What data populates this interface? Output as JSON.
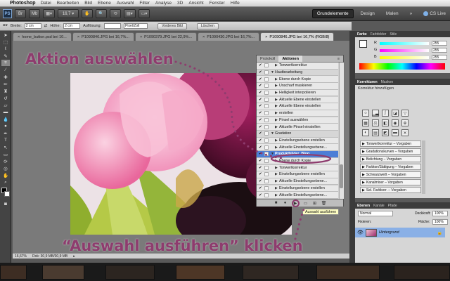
{
  "menubar": {
    "apple": "",
    "app_name": "Photoshop",
    "items": [
      "Datei",
      "Bearbeiten",
      "Bild",
      "Ebene",
      "Auswahl",
      "Filter",
      "Analyse",
      "3D",
      "Ansicht",
      "Fenster",
      "Hilfe"
    ]
  },
  "appbar": {
    "logo": "PS",
    "zoom": "16,7",
    "workspaces": [
      "Grundelemente",
      "Design",
      "Malen"
    ],
    "more": "»",
    "cs_live": "CS Live"
  },
  "options": {
    "width_label": "Breite:",
    "width_value": "2 cm",
    "height_label": "Höhe:",
    "height_value": "2 cm",
    "resolution_label": "Auflösung:",
    "unit_value": "Pixel/Zoll",
    "front_image": "Vorderes Bild",
    "clear": "Löschen"
  },
  "document_tabs": [
    {
      "label": "home_button.psd bei 10...",
      "active": false
    },
    {
      "label": "P1090846.JPG bei 16,7%...",
      "active": false
    },
    {
      "label": "P1090379.JPG bei 22,9%...",
      "active": false
    },
    {
      "label": "P1090430.JPG bei 16,7%...",
      "active": false
    },
    {
      "label": "P1090846.JPG bei 16,7% (RGB/8)",
      "active": true
    }
  ],
  "status": {
    "zoom": "16,67%",
    "doc": "Dok: 30,9 MB/30,9 MB"
  },
  "actions_panel": {
    "tabs": [
      "Protokoll",
      "Aktionen"
    ],
    "rows": [
      {
        "text": "Tonwertkorrektur",
        "indent": 2,
        "kind": "step"
      },
      {
        "text": "Hautbearbeitung",
        "indent": 1,
        "kind": "action"
      },
      {
        "text": "Ebene durch Kopie",
        "indent": 2,
        "kind": "step"
      },
      {
        "text": "Unscharf maskieren",
        "indent": 2,
        "kind": "step"
      },
      {
        "text": "Helligkeit interpolieren",
        "indent": 2,
        "kind": "step"
      },
      {
        "text": "Aktuelle Ebene einstellen",
        "indent": 2,
        "kind": "step"
      },
      {
        "text": "Aktuelle Ebene einstellen",
        "indent": 2,
        "kind": "step"
      },
      {
        "text": "erstellen",
        "indent": 2,
        "kind": "step"
      },
      {
        "text": "Pinsel auswählen",
        "indent": 2,
        "kind": "step"
      },
      {
        "text": "Aktuelle Pinsel einstellen",
        "indent": 2,
        "kind": "step"
      },
      {
        "text": "Gradation",
        "indent": 1,
        "kind": "action"
      },
      {
        "text": "Einstellungsebene erstellen",
        "indent": 2,
        "kind": "step"
      },
      {
        "text": "Aktuelle Einstellungsebene...",
        "indent": 2,
        "kind": "step"
      },
      {
        "text": "Produktbilder_Blog",
        "indent": 1,
        "kind": "selected"
      },
      {
        "text": "Ebene durch Kopie",
        "indent": 2,
        "kind": "step"
      },
      {
        "text": "Tonwertkorrektur",
        "indent": 2,
        "kind": "step"
      },
      {
        "text": "Einstellungsebene erstellen",
        "indent": 2,
        "kind": "step"
      },
      {
        "text": "Aktuelle Einstellungsebene...",
        "indent": 2,
        "kind": "step"
      },
      {
        "text": "Einstellungsebene erstellen",
        "indent": 2,
        "kind": "step"
      },
      {
        "text": "Aktuelle Einstellungsebene...",
        "indent": 2,
        "kind": "step"
      }
    ],
    "tooltip": "Auswahl ausführen"
  },
  "color_panel": {
    "tabs": [
      "Farbe",
      "Farbfelder",
      "Stile"
    ],
    "r": "255",
    "g": "255",
    "b": "255"
  },
  "corrections_panel": {
    "tabs": [
      "Korrekturen",
      "Masken"
    ],
    "subtitle": "Korrektur hinzufügen",
    "presets": [
      "Tonwertkorrektur – Vorgaben",
      "Gradationskurven – Vorgaben",
      "Belichtung – Vorgaben",
      "Farbton/Sättigung – Vorgaben",
      "Schwarzweiß – Vorgaben",
      "Kanalmixer – Vorgaben",
      "Sel. Farbkorr. – Vorgaben"
    ]
  },
  "layers_panel": {
    "tabs": [
      "Ebenen",
      "Kanäle",
      "Pfade"
    ],
    "mode": "Normal",
    "opacity_label": "Deckkraft:",
    "opacity_value": "100%",
    "fix_label": "Fixieren:",
    "fill_label": "Fläche:",
    "fill_value": "100%",
    "layer_name": "Hintergrund"
  },
  "callouts": {
    "top": "Aktion auswählen",
    "bottom": "“Auswahl ausführen” klicken"
  },
  "colors": {
    "callout": "#8e3c6e",
    "selection": "#4d7ed6",
    "tooltip": "#ffffc4"
  },
  "icons": {
    "tools": [
      "move",
      "marquee",
      "lasso",
      "quick-select",
      "crop",
      "eyedropper",
      "healing",
      "brush",
      "stamp",
      "history-brush",
      "eraser",
      "gradient",
      "blur",
      "dodge",
      "pen",
      "type",
      "path-select",
      "shape",
      "3d-rotate",
      "3d-orbit",
      "hand",
      "zoom"
    ]
  }
}
